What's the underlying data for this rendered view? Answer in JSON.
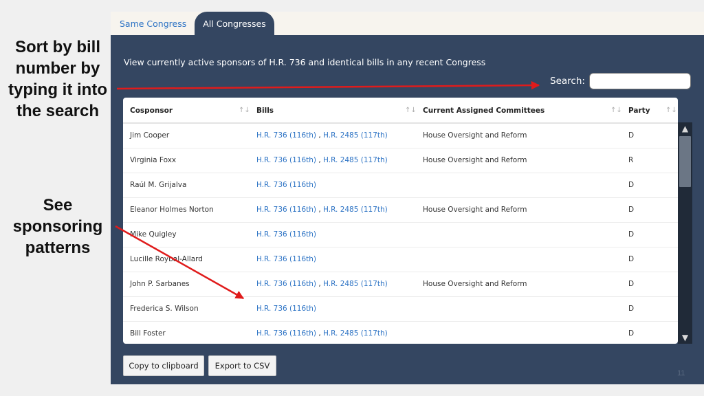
{
  "annotations": {
    "sort_text": "Sort by bill number by typing it into the search",
    "patterns_text": "See sponsoring patterns"
  },
  "tabs": [
    {
      "label": "Same Congress",
      "active": false
    },
    {
      "label": "All Congresses",
      "active": true
    }
  ],
  "intro": "View currently active sponsors of H.R. 736 and identical bills in any recent Congress",
  "search": {
    "label": "Search:",
    "value": ""
  },
  "table": {
    "columns": [
      "Cosponsor",
      "Bills",
      "Current Assigned Committees",
      "Party"
    ],
    "sort_icon": "↑↓",
    "rows": [
      {
        "cosponsor": "Jim Cooper",
        "bills": [
          "H.R. 736 (116th)",
          "H.R. 2485 (117th)"
        ],
        "committee": "House Oversight and Reform",
        "party": "D"
      },
      {
        "cosponsor": "Virginia Foxx",
        "bills": [
          "H.R. 736 (116th)",
          "H.R. 2485 (117th)"
        ],
        "committee": "House Oversight and Reform",
        "party": "R"
      },
      {
        "cosponsor": "Raúl M. Grijalva",
        "bills": [
          "H.R. 736 (116th)"
        ],
        "committee": "",
        "party": "D"
      },
      {
        "cosponsor": "Eleanor Holmes Norton",
        "bills": [
          "H.R. 736 (116th)",
          "H.R. 2485 (117th)"
        ],
        "committee": "House Oversight and Reform",
        "party": "D"
      },
      {
        "cosponsor": "Mike Quigley",
        "bills": [
          "H.R. 736 (116th)"
        ],
        "committee": "",
        "party": "D"
      },
      {
        "cosponsor": "Lucille Roybal-Allard",
        "bills": [
          "H.R. 736 (116th)"
        ],
        "committee": "",
        "party": "D"
      },
      {
        "cosponsor": "John P. Sarbanes",
        "bills": [
          "H.R. 736 (116th)",
          "H.R. 2485 (117th)"
        ],
        "committee": "House Oversight and Reform",
        "party": "D"
      },
      {
        "cosponsor": "Frederica S. Wilson",
        "bills": [
          "H.R. 736 (116th)"
        ],
        "committee": "",
        "party": "D"
      },
      {
        "cosponsor": "Bill Foster",
        "bills": [
          "H.R. 736 (116th)",
          "H.R. 2485 (117th)"
        ],
        "committee": "",
        "party": "D"
      }
    ]
  },
  "buttons": {
    "copy": "Copy to clipboard",
    "export": "Export to CSV"
  },
  "slide_number": "11",
  "colors": {
    "panel": "#344661",
    "link": "#2b72c4",
    "arrow": "#e01b1b"
  },
  "icons": {
    "scroll_up": "chevron-up-icon",
    "scroll_down": "chevron-down-icon",
    "sort": "sort-icon"
  }
}
